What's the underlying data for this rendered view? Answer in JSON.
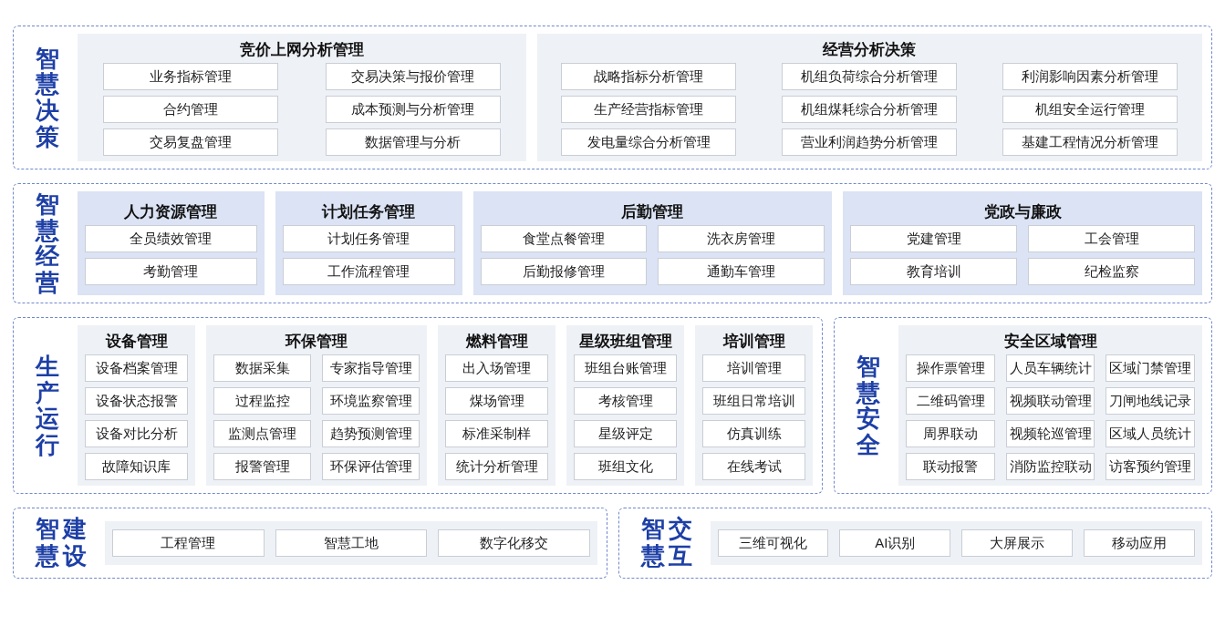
{
  "rows": [
    {
      "sections": [
        {
          "title": "智慧决策",
          "kind": "vertical",
          "groups": [
            {
              "title": "竞价上网分析管理",
              "items": [
                "业务指标管理",
                "交易决策与报价管理",
                "合约管理",
                "成本预测与分析管理",
                "交易复盘管理",
                "数据管理与分析"
              ]
            },
            {
              "title": "经营分析决策",
              "items": [
                "战略指标分析管理",
                "机组负荷综合分析管理",
                "利润影响因素分析管理",
                "生产经营指标管理",
                "机组煤耗综合分析管理",
                "机组安全运行管理",
                "发电量综合分析管理",
                "营业利润趋势分析管理",
                "基建工程情况分析管理"
              ]
            }
          ]
        }
      ]
    },
    {
      "sections": [
        {
          "title": "智慧经营",
          "kind": "vertical",
          "groups": [
            {
              "title": "人力资源管理",
              "items": [
                "全员绩效管理",
                "考勤管理"
              ]
            },
            {
              "title": "计划任务管理",
              "items": [
                "计划任务管理",
                "工作流程管理"
              ]
            },
            {
              "title": "后勤管理",
              "items": [
                "食堂点餐管理",
                "洗衣房管理",
                "后勤报修管理",
                "通勤车管理"
              ]
            },
            {
              "title": "党政与廉政",
              "items": [
                "党建管理",
                "工会管理",
                "教育培训",
                "纪检监察"
              ]
            }
          ]
        }
      ]
    },
    {
      "sections": [
        {
          "title": "生产运行",
          "kind": "vertical",
          "groups": [
            {
              "title": "设备管理",
              "items": [
                "设备档案管理",
                "设备状态报警",
                "设备对比分析",
                "故障知识库"
              ]
            },
            {
              "title": "环保管理",
              "items": [
                "数据采集",
                "专家指导管理",
                "过程监控",
                "环境监察管理",
                "监测点管理",
                "趋势预测管理",
                "报警管理",
                "环保评估管理"
              ]
            },
            {
              "title": "燃料管理",
              "items": [
                "出入场管理",
                "煤场管理",
                "标准采制样",
                "统计分析管理"
              ]
            },
            {
              "title": "星级班组管理",
              "items": [
                "班组台账管理",
                "考核管理",
                "星级评定",
                "班组文化"
              ]
            },
            {
              "title": "培训管理",
              "items": [
                "培训管理",
                "班组日常培训",
                "仿真训练",
                "在线考试"
              ]
            }
          ]
        },
        {
          "title": "智慧安全",
          "kind": "vertical",
          "groups": [
            {
              "title": "安全区域管理",
              "items": [
                "操作票管理",
                "人员车辆统计",
                "区域门禁管理",
                "二维码管理",
                "视频联动管理",
                "刀闸地线记录",
                "周界联动",
                "视频轮巡管理",
                "区域人员统计",
                "联动报警",
                "消防监控联动",
                "访客预约管理"
              ]
            }
          ]
        }
      ]
    },
    {
      "sections": [
        {
          "title": "智慧建设",
          "kind": "grid",
          "groups": [
            {
              "items": [
                "工程管理",
                "智慧工地",
                "数字化移交"
              ]
            }
          ]
        },
        {
          "title": "智慧交互",
          "kind": "grid",
          "groups": [
            {
              "items": [
                "三维可视化",
                "AI识别",
                "大屏展示",
                "移动应用"
              ]
            }
          ]
        }
      ]
    }
  ]
}
